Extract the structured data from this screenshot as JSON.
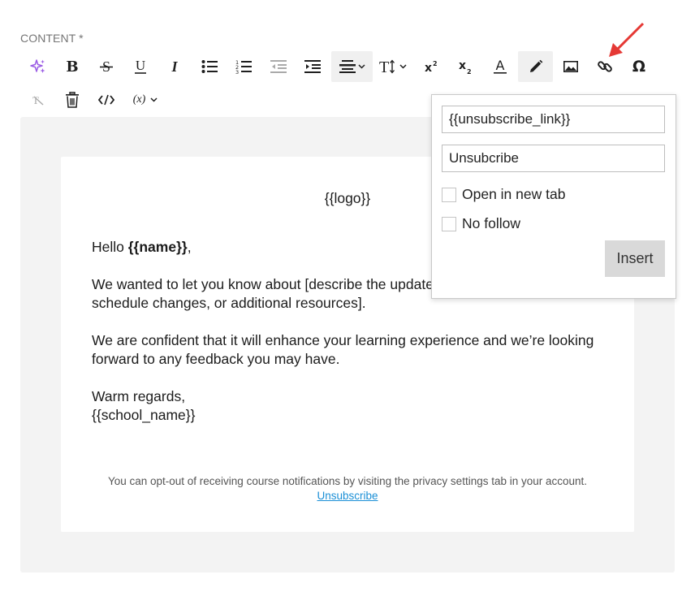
{
  "field_label": "CONTENT *",
  "toolbar": {
    "text_size_label": "T",
    "superscript_label": "x",
    "superscript_mark": "2",
    "subscript_label": "x",
    "subscript_mark": "2",
    "special_char": "Ω",
    "variable_label": "(x)",
    "icons": [
      "ai-sparkle-icon",
      "bold-icon",
      "strikethrough-icon",
      "underline-icon",
      "italic-icon",
      "bullet-list-icon",
      "numbered-list-icon",
      "outdent-icon",
      "indent-icon",
      "align-icon",
      "text-size-icon",
      "superscript-icon",
      "subscript-icon",
      "font-color-icon",
      "pencil-icon",
      "image-icon",
      "link-icon",
      "omega-icon",
      "clear-format-icon",
      "trash-icon",
      "code-icon",
      "variable-icon"
    ]
  },
  "email": {
    "logo": "{{logo}}",
    "greeting_prefix": "Hello ",
    "greeting_name": "{{name}}",
    "greeting_suffix": ",",
    "para1_line1": "We wanted to let you know about [describe the update",
    "para1_line2": "schedule changes, or additional resources].",
    "para2_line1": "We are confident that it will enhance your learning experience and we’re looking",
    "para2_line2": "forward to any feedback you may have.",
    "signoff": "Warm regards,",
    "signature": "{{school_name}}",
    "footer_note": "You can opt-out of receiving course notifications by visiting the privacy settings tab in your account.",
    "footer_link": "Unsubscribe"
  },
  "link_popup": {
    "url_value": "{{unsubscribe_link}}",
    "text_value": "Unsubcribe",
    "open_new_tab_label": "Open in new tab",
    "no_follow_label": "No follow",
    "insert_label": "Insert"
  },
  "colors": {
    "sparkle": "#9b5de5",
    "arrow": "#e53935",
    "link": "#1a8fd6",
    "editor_bg": "#f3f3f3"
  }
}
